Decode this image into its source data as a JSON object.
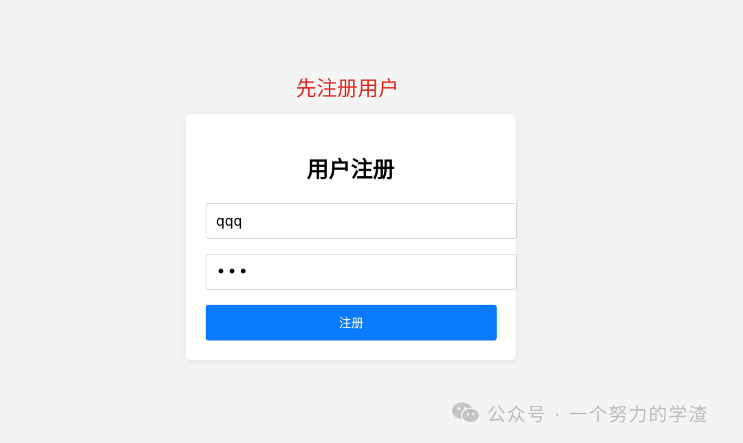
{
  "annotation": "先注册用户",
  "form": {
    "title": "用户注册",
    "username_value": "qqq",
    "password_value": "•••",
    "submit_label": "注册"
  },
  "watermark": {
    "icon": "wechat-icon",
    "text": "公众号 · 一个努力的学渣"
  },
  "colors": {
    "annotation": "#e02a1f",
    "button": "#0a7bff",
    "background": "#f4f4f4"
  }
}
